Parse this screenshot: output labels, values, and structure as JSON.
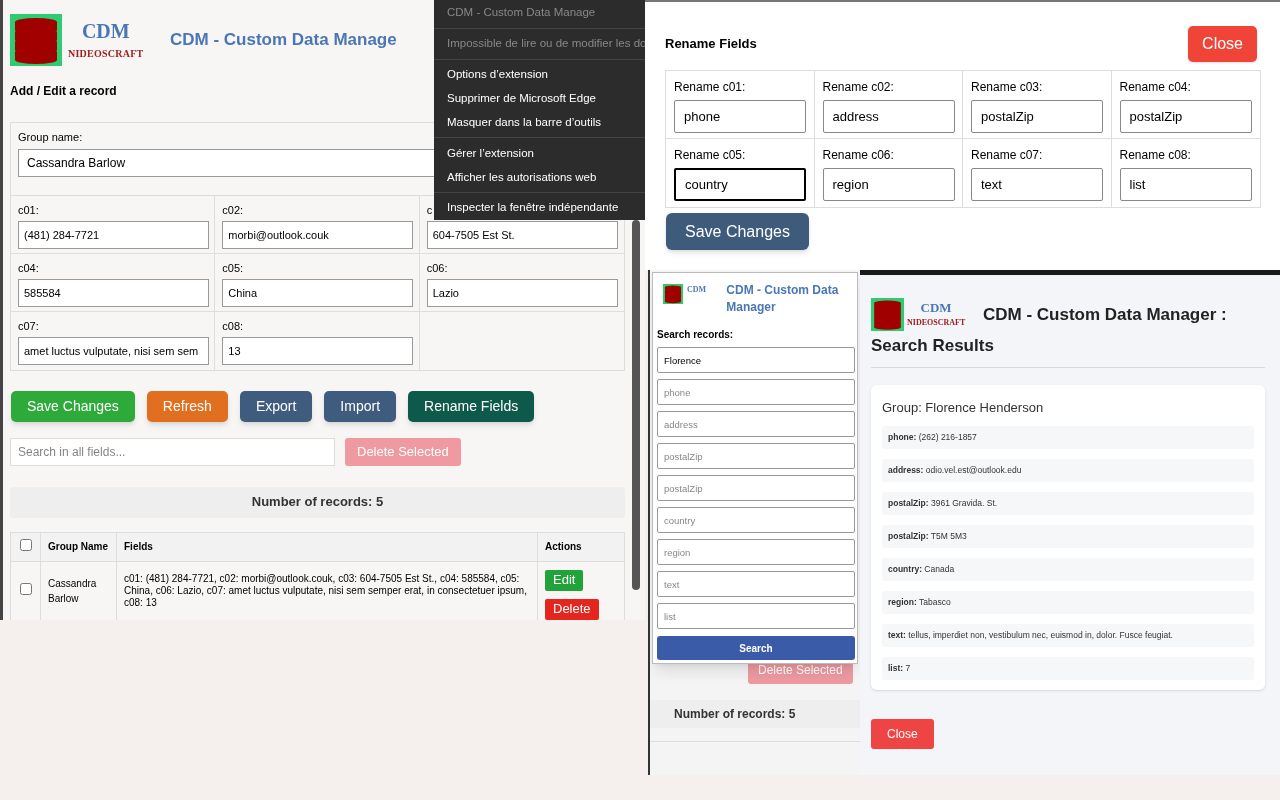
{
  "editor": {
    "logo": {
      "title": "CDM",
      "subtitle": "NIDEOSCRAFT"
    },
    "title": "CDM - Custom Data Manage",
    "section_title": "Add / Edit a record",
    "group_name": {
      "label": "Group name:",
      "value": "Cassandra Barlow"
    },
    "fields": [
      {
        "label": "c01:",
        "value": "(481) 284-7721"
      },
      {
        "label": "c02:",
        "value": "morbi@outlook.couk"
      },
      {
        "label": "c",
        "value": "604-7505 Est St."
      },
      {
        "label": "c04:",
        "value": "585584"
      },
      {
        "label": "c05:",
        "value": "China"
      },
      {
        "label": "c06:",
        "value": "Lazio"
      },
      {
        "label": "c07:",
        "value": "amet luctus vulputate, nisi sem sem"
      },
      {
        "label": "c08:",
        "value": "13"
      }
    ],
    "buttons": [
      {
        "label": "Save Changes",
        "color": "#2eaa3a"
      },
      {
        "label": "Refresh",
        "color": "#e07020"
      },
      {
        "label": "Export",
        "color": "#3f5c7e"
      },
      {
        "label": "Import",
        "color": "#3f5c7e"
      },
      {
        "label": "Rename Fields",
        "color": "#0e5a4a"
      }
    ],
    "search": {
      "placeholder": "Search in all fields..."
    },
    "delete_selected": {
      "label": "Delete Selected",
      "disabled": true
    },
    "record_count": "Number of records: 5",
    "table": {
      "columns": [
        "Group Name",
        "Fields",
        "Actions"
      ],
      "header_checked": false,
      "rows": [
        {
          "checked": false,
          "group_name": "Cassandra Barlow",
          "fields": "c01: (481) 284-7721, c02: morbi@outlook.couk, c03: 604-7505 Est St., c04: 585584, c05: China, c06: Lazio, c07: amet luctus vulputate, nisi sem semper erat, in consectetuer ipsum, c08: 13",
          "actions": [
            {
              "label": "Edit",
              "color": "#22a33a"
            },
            {
              "label": "Delete",
              "color": "#e5261f"
            }
          ]
        }
      ]
    }
  },
  "context_menu": {
    "groups": [
      [
        {
          "label": "CDM - Custom Data Manage",
          "disabled": true
        }
      ],
      [
        {
          "label": "Impossible de lire ou de modifier les do",
          "disabled": true
        }
      ],
      [
        {
          "label": "Options d’extension",
          "disabled": false
        },
        {
          "label": "Supprimer de Microsoft Edge",
          "disabled": false
        },
        {
          "label": "Masquer dans la barre d’outils",
          "disabled": false
        }
      ],
      [
        {
          "label": "Gérer l’extension",
          "disabled": false
        },
        {
          "label": "Afficher les autorisations web",
          "disabled": false
        }
      ],
      [
        {
          "label": "Inspecter la fenêtre indépendante",
          "disabled": false
        }
      ]
    ]
  },
  "rename_dialog": {
    "title": "Rename Fields",
    "close": "Close",
    "fields": [
      {
        "label": "Rename c01:",
        "value": "phone",
        "focused": false
      },
      {
        "label": "Rename c02:",
        "value": "address",
        "focused": false
      },
      {
        "label": "Rename c03:",
        "value": "postalZip",
        "focused": false
      },
      {
        "label": "Rename c04:",
        "value": "postalZip",
        "focused": false
      },
      {
        "label": "Rename c05:",
        "value": "country",
        "focused": true
      },
      {
        "label": "Rename c06:",
        "value": "region",
        "focused": false
      },
      {
        "label": "Rename c07:",
        "value": "text",
        "focused": false
      },
      {
        "label": "Rename c08:",
        "value": "list",
        "focused": false
      }
    ],
    "save": "Save Changes"
  },
  "search_popup": {
    "logo": {
      "title": "CDM"
    },
    "title": "CDM - Custom Data Manager",
    "label": "Search records:",
    "fields": [
      {
        "value": "Florence"
      },
      {
        "placeholder": "phone"
      },
      {
        "placeholder": "address"
      },
      {
        "placeholder": "postalZip"
      },
      {
        "placeholder": "postalZip"
      },
      {
        "placeholder": "country"
      },
      {
        "placeholder": "region"
      },
      {
        "placeholder": "text"
      },
      {
        "placeholder": "list"
      }
    ],
    "button": "Search",
    "background": {
      "delete_selected": "Delete Selected",
      "record_count": "Number of records: 5"
    }
  },
  "search_results": {
    "logo": {
      "title": "CDM",
      "subtitle": "NIDEOSCRAFT"
    },
    "heading": "CDM - Custom Data Manager :",
    "subheading": "Search Results",
    "card": {
      "group": "Group: Florence Henderson",
      "rows": [
        "**phone:** (262) 216-1857",
        "**address:** odio.vel.est@outlook.edu",
        "**postalZip:** 3961 Gravida. St.",
        "**postalZip:** T5M 5M3",
        "**country:** Canada",
        "**region:** Tabasco",
        "**text:** tellus, imperdiet non, vestibulum nec, euismod in, dolor. Fusce feugiat.",
        "**list:** 7"
      ]
    },
    "close": "Close"
  }
}
